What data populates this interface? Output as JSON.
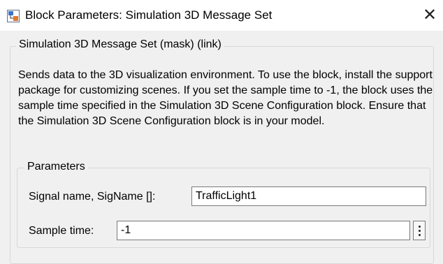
{
  "window": {
    "title": "Block Parameters: Simulation 3D Message Set",
    "close_glyph": "✕"
  },
  "block": {
    "group_title": "Simulation 3D Message Set (mask) (link)",
    "description": "Sends data to the 3D visualization environment. To use the block, install the support package for customizing scenes. If you set the sample time to -1, the block uses the sample time specified in the Simulation 3D Scene Configuration block. Ensure that the Simulation 3D Scene Configuration block is in your model."
  },
  "parameters": {
    "group_title": "Parameters",
    "signal_name_label": "Signal name, SigName []:",
    "signal_name_value": "TrafficLight1",
    "sample_time_label": "Sample time:",
    "sample_time_value": "-1"
  },
  "icons": {
    "app": "simulink-block-icon",
    "close": "close-icon",
    "more": "more-options-icon"
  }
}
